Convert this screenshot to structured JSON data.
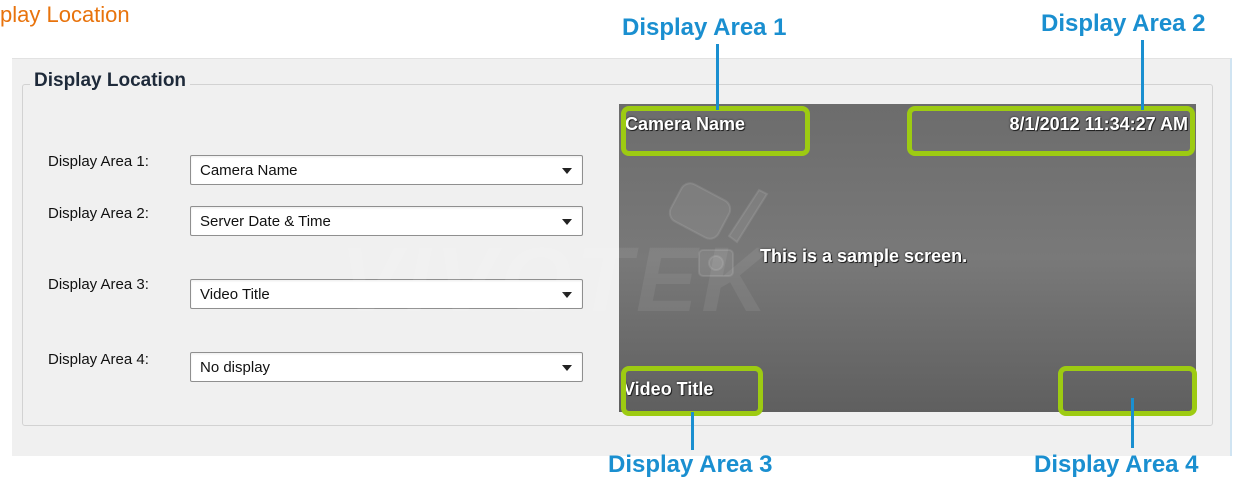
{
  "page": {
    "heading": "play Location"
  },
  "group": {
    "title": "Display Location"
  },
  "rows": [
    {
      "label": "Display Area 1:",
      "value": "Camera Name"
    },
    {
      "label": "Display Area 2:",
      "value": "Server Date & Time"
    },
    {
      "label": "Display Area 3:",
      "value": "Video Title"
    },
    {
      "label": "Display Area 4:",
      "value": "No display"
    }
  ],
  "preview": {
    "area1_text": "Camera Name",
    "area2_text": "8/1/2012 11:34:27 AM",
    "area3_text": "Video Title",
    "center_text": "This is a sample screen.",
    "watermark": "VIVOTEK"
  },
  "callouts": {
    "area1": "Display Area 1",
    "area2": "Display Area 2",
    "area3": "Display Area 3",
    "area4": "Display Area 4"
  },
  "colors": {
    "heading": "#e8730c",
    "callout": "#1a8fd0",
    "highlight": "#9dcb12",
    "preview_bg": "#6c6c6c"
  }
}
